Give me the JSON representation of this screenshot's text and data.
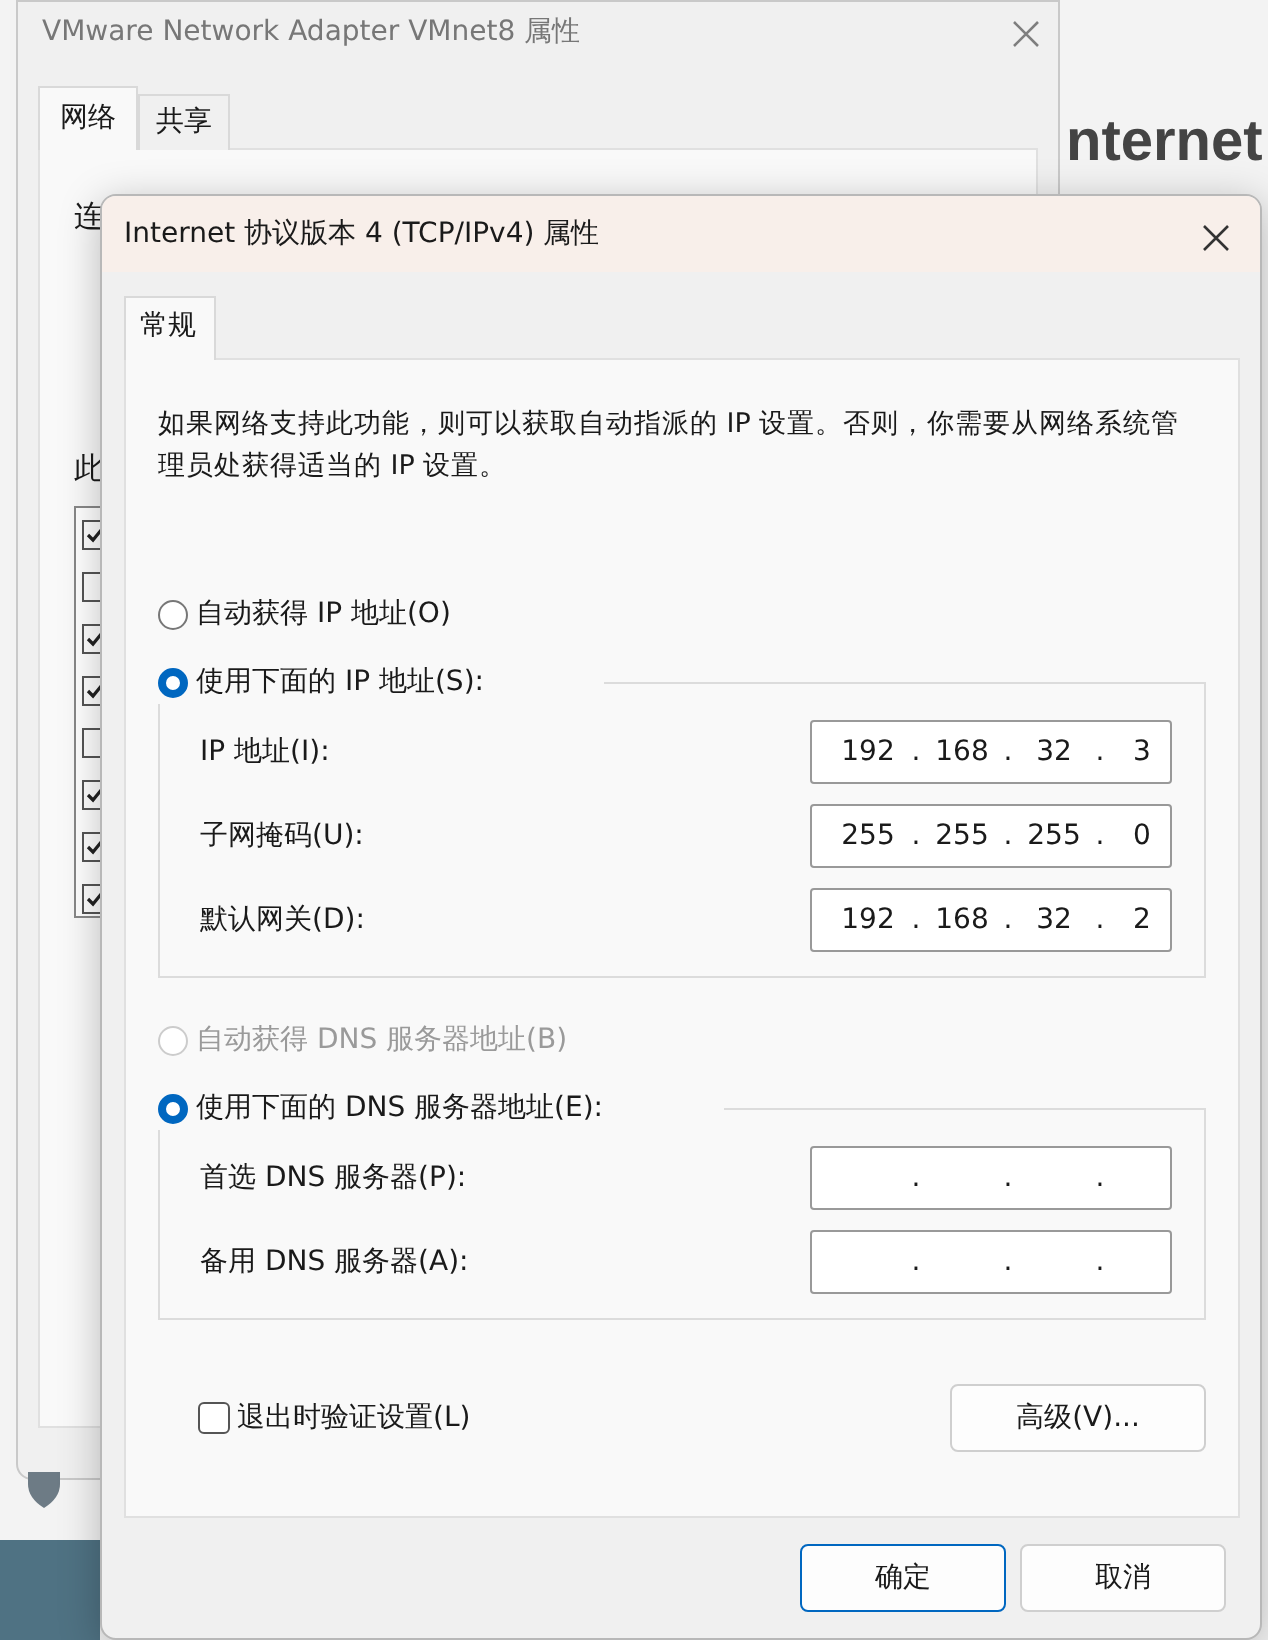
{
  "background_heading": "nternet",
  "back_window": {
    "title": "VMware Network Adapter VMnet8 属性",
    "tabs": [
      {
        "label": "网络",
        "selected": true
      },
      {
        "label": "共享",
        "selected": false
      }
    ],
    "label_1": "连",
    "label_2": "此",
    "items": [
      {
        "checked": true
      },
      {
        "checked": false
      },
      {
        "checked": true
      },
      {
        "checked": true
      },
      {
        "checked": false
      },
      {
        "checked": true
      },
      {
        "checked": true
      },
      {
        "checked": true
      }
    ]
  },
  "dialog": {
    "title": "Internet 协议版本 4 (TCP/IPv4) 属性",
    "tabs": [
      {
        "label": "常规",
        "selected": true
      }
    ],
    "description": "如果网络支持此功能，则可以获取自动指派的 IP 设置。否则，你需要从网络系统管理员处获得适当的 IP 设置。",
    "ip_options": [
      {
        "label": "自动获得 IP 地址(O)",
        "selected": false,
        "disabled": false
      },
      {
        "label": "使用下面的 IP 地址(S):",
        "selected": true,
        "disabled": false
      }
    ],
    "ip_fields": [
      {
        "label": "IP 地址(I):",
        "octets": [
          "192",
          "168",
          "32",
          "3"
        ],
        "separator": "."
      },
      {
        "label": "子网掩码(U):",
        "octets": [
          "255",
          "255",
          "255",
          "0"
        ],
        "separator": "."
      },
      {
        "label": "默认网关(D):",
        "octets": [
          "192",
          "168",
          "32",
          "2"
        ],
        "separator": "."
      }
    ],
    "dns_options": [
      {
        "label": "自动获得 DNS 服务器地址(B)",
        "selected": false,
        "disabled": true
      },
      {
        "label": "使用下面的 DNS 服务器地址(E):",
        "selected": true,
        "disabled": false
      }
    ],
    "dns_fields": [
      {
        "label": "首选 DNS 服务器(P):",
        "separator": "."
      },
      {
        "label": "备用 DNS 服务器(A):",
        "separator": "."
      }
    ],
    "validate": {
      "label": "退出时验证设置(L)",
      "checked": false
    },
    "advanced_button": "高级(V)...",
    "buttons": [
      {
        "label": "确定",
        "default": true
      },
      {
        "label": "取消",
        "default": false
      }
    ]
  }
}
